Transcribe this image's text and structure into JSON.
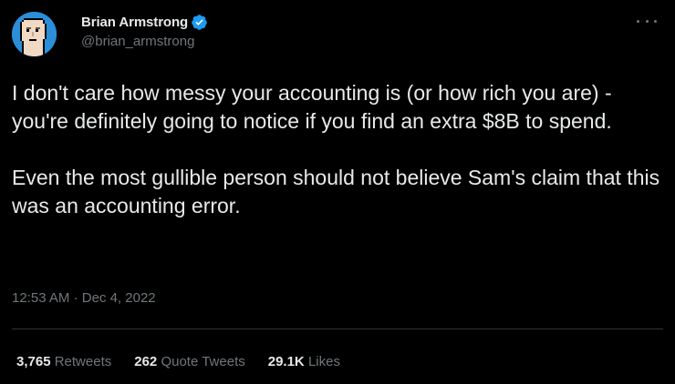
{
  "author": {
    "display_name": "Brian Armstrong",
    "handle": "@brian_armstrong",
    "verified": true,
    "verified_color": "#1d9bf0",
    "avatar_icon": "pixel-punk-avatar"
  },
  "tweet": {
    "paragraphs": [
      "I don't care how messy your accounting is (or how rich you are) - you're definitely going to notice if you find an extra $8B to spend.",
      "Even the most gullible person should not believe Sam's claim that this was an accounting error."
    ],
    "time": "12:53 AM",
    "separator": "·",
    "date": "Dec 4, 2022"
  },
  "stats": {
    "retweets": {
      "count": "3,765",
      "label": "Retweets"
    },
    "quote_tweets": {
      "count": "262",
      "label": "Quote Tweets"
    },
    "likes": {
      "count": "29.1K",
      "label": "Likes"
    }
  },
  "colors": {
    "background": "#000000",
    "text": "#e7e9ea",
    "secondary": "#71767b",
    "divider": "#2f3336"
  }
}
